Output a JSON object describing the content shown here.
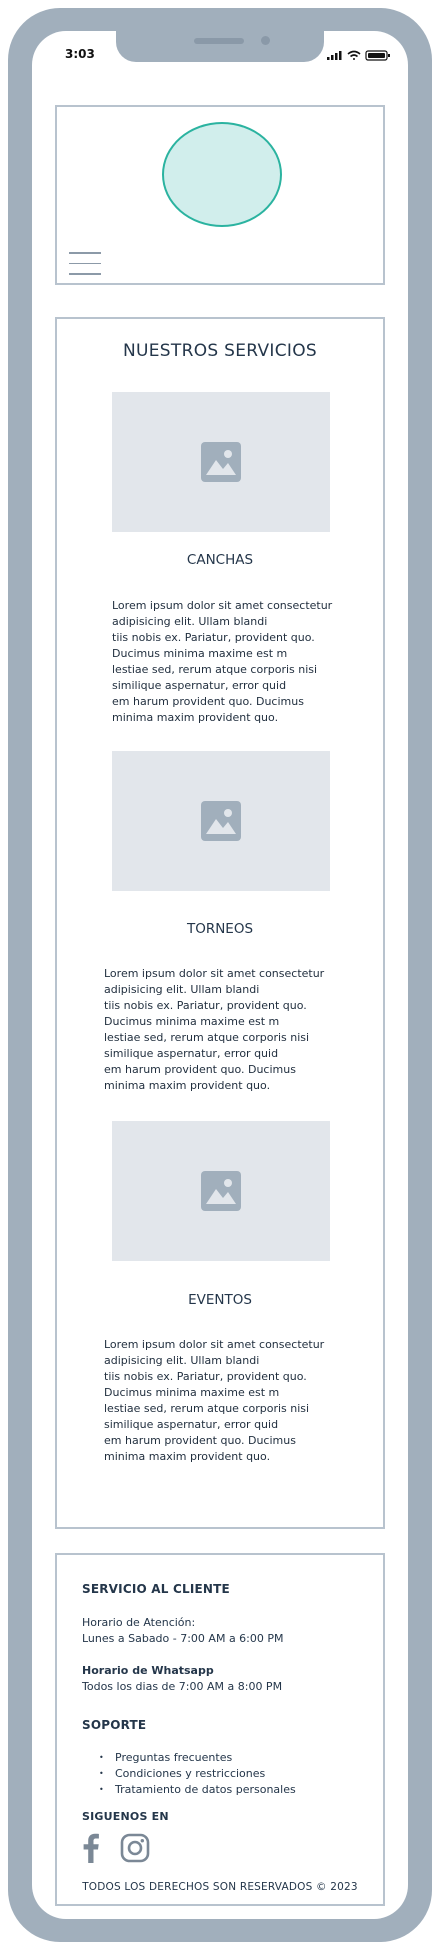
{
  "status_bar": {
    "time": "3:03"
  },
  "services": {
    "title": "NUESTROS SERVICIOS",
    "items": [
      {
        "title": "CANCHAS",
        "text": "Lorem ipsum dolor sit amet consectetur\nadipisicing elit. Ullam blandi\ntiis nobis ex. Pariatur, provident quo.\nDucimus minima maxime est m\nlestiae sed, rerum atque corporis nisi\nsimilique aspernatur, error quid\nem harum provident quo. Ducimus\nminima maxim provident quo."
      },
      {
        "title": "TORNEOS",
        "text": "Lorem ipsum dolor sit amet consectetur\nadipisicing elit. Ullam blandi\ntiis nobis ex. Pariatur, provident quo.\nDucimus minima maxime est m\nlestiae sed, rerum atque corporis nisi\nsimilique aspernatur, error quid\nem harum provident quo. Ducimus\nminima maxim provident quo."
      },
      {
        "title": "EVENTOS",
        "text": "Lorem ipsum dolor sit amet consectetur\nadipisicing elit. Ullam blandi\ntiis nobis ex. Pariatur, provident quo.\nDucimus minima maxime est m\nlestiae sed, rerum atque corporis nisi\nsimilique aspernatur, error quid\nem harum provident quo. Ducimus\nminima maxim provident quo."
      }
    ]
  },
  "footer": {
    "customer_service_heading": "SERVICIO AL CLIENTE",
    "attention_label": "Horario de Atención:",
    "attention_hours": "Lunes a Sabado - 7:00 AM a 6:00 PM",
    "whatsapp_label": "Horario de Whatsapp",
    "whatsapp_hours": "Todos los dias de 7:00 AM a 8:00 PM",
    "support_heading": "SOPORTE",
    "support_links": [
      "Preguntas frecuentes",
      "Condiciones y restricciones",
      "Tratamiento de datos personales"
    ],
    "follow_heading": "SIGUENOS EN",
    "social_icons": [
      "facebook-icon",
      "instagram-icon"
    ],
    "copyright": "TODOS LOS DERECHOS SON RESERVADOS © 2023"
  },
  "colors": {
    "frame": "#a1afbc",
    "logo_fill": "#d1eeec",
    "logo_stroke": "#2bb3a0",
    "placeholder_bg": "#e2e6eb",
    "placeholder_icon": "#a1afbc",
    "box_border": "#b8c3ce",
    "text": "#24364a"
  }
}
